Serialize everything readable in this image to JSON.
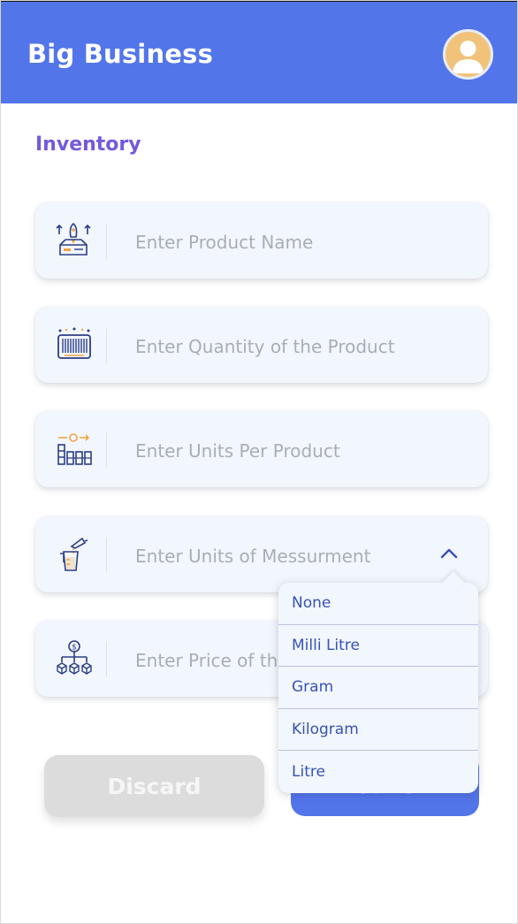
{
  "header": {
    "app_title": "Big Business"
  },
  "main": {
    "section_title": "Inventory",
    "fields": [
      {
        "icon": "product-launch-icon",
        "placeholder": "Enter Product Name"
      },
      {
        "icon": "barcode-icon",
        "placeholder": "Enter Quantity of the Product"
      },
      {
        "icon": "boxes-settings-icon",
        "placeholder": "Enter Units Per Product"
      },
      {
        "icon": "measuring-cup-icon",
        "placeholder": "Enter Units of Messurment"
      },
      {
        "icon": "price-hierarchy-icon",
        "placeholder": "Enter Price of th"
      }
    ]
  },
  "actions": {
    "discard_label": "Discard",
    "save_label": "Save"
  },
  "dropdown": {
    "options": [
      "None",
      "Milli Litre",
      "Gram",
      "Kilogram",
      "Litre"
    ]
  },
  "colors": {
    "primary": "#5275ea",
    "accent_title": "#7559dc",
    "field_bg": "#f2f6fd",
    "placeholder": "#a9adb6",
    "dropdown_text": "#3753b5",
    "icon_blue": "#2b3e86",
    "icon_orange": "#f0a640"
  }
}
